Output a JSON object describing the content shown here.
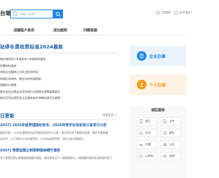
{
  "header": {
    "brand_text": "台端",
    "search_placeholder": "请输入关键字",
    "links": [
      {
        "label": "无障碍",
        "icon": "accessibility-icon"
      },
      {
        "label": "关于我们",
        "icon": "info-icon"
      }
    ]
  },
  "nav": {
    "items": [
      "成都医户资讯",
      "成功案例",
      "问题答疑"
    ]
  },
  "guide": {
    "title": "站停车费收费标准2024最新",
    "items": [
      "城市规划局+申请条件+申请材料要求",
      "所需材料清单",
      "申报企业解除公司社会信用合同",
      "申请分年审申，需五年申申请指南",
      "强制执行政策",
      "新社会创业基金及现合规行内管理生保障政策提交",
      "按社区劳动保险及认证服务条件审审申请平台政策"
    ]
  },
  "side_cards": {
    "business": {
      "label": "企业办事",
      "color": "#1e88e5",
      "icon": "building-icon"
    },
    "personal": {
      "label": "个人办事",
      "color": "#f39c12",
      "icon": "person-icon"
    }
  },
  "news": {
    "title": "日更新",
    "more": "查看更多 >",
    "articles": [
      {
        "headline": "2037]  2026年度梦理提纪念币、2026年贺岁纪念钞浙江省发行公告",
        "lines": [
          "通讯社报：2026年度贺岁纪念币和纪念钞发行公告，请大家及时了解相关信息，做好兑换准备",
          "纪念币：以下同时2026年度贺岁，2026年度贺岁钞，发行公告内容详见"
        ]
      },
      {
        "headline": "2037]  恢营运营止和限制振纳细竹通告",
        "lines": [
          "关于恢营运营止和限制振纳细竹通告，相关单位及个人请遵照执行，如有疑问请咨询当地相关部门"
        ]
      }
    ]
  },
  "services": {
    "title": "城区服务",
    "items": [
      {
        "label": "发行",
        "icon": "document-icon"
      },
      {
        "label": "立件",
        "icon": "file-icon"
      },
      {
        "label": "生活",
        "icon": "home-icon"
      },
      {
        "label": "就业",
        "icon": "briefcase-icon"
      },
      {
        "label": "交通",
        "icon": "car-icon"
      },
      {
        "label": "公证",
        "icon": "stamp-icon"
      },
      {
        "label": "公积金",
        "icon": "coin-icon"
      },
      {
        "label": "证明",
        "icon": "certificate-icon"
      }
    ]
  }
}
